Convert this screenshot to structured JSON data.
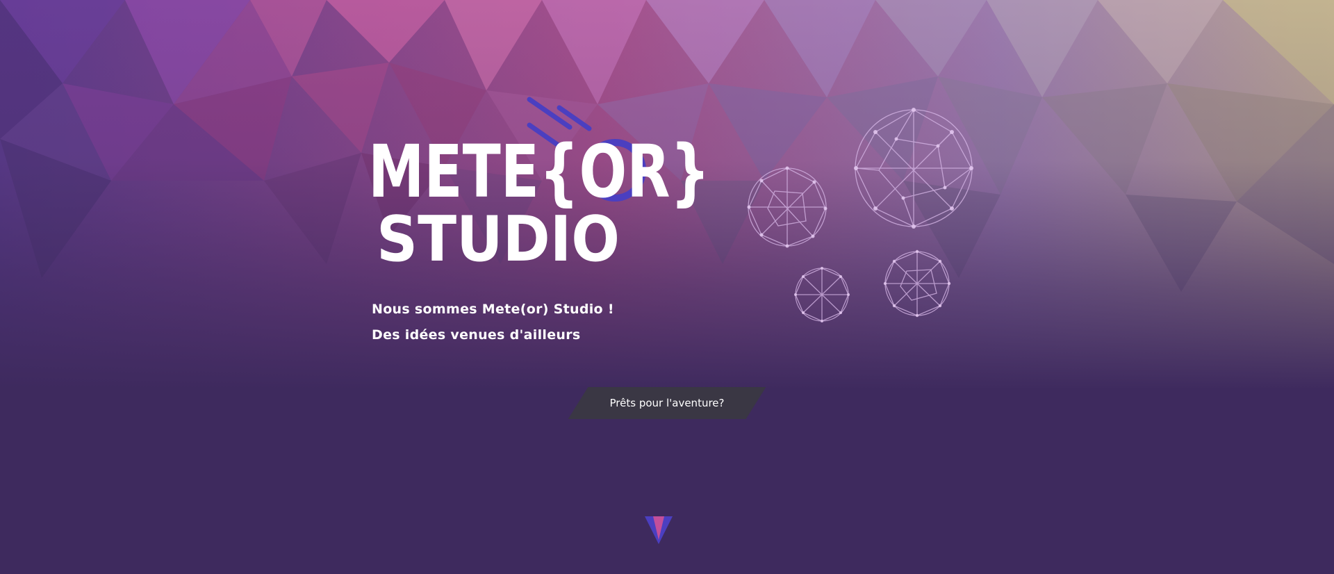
{
  "hero": {
    "logo_text_line1": "METE{OR}",
    "logo_text_line2": "STUDIO",
    "tagline_1": "Nous sommes Mete(or) Studio !",
    "tagline_2": "Des idées venues d'ailleurs",
    "cta_label": "Prêts pour l'aventure?"
  },
  "icons": {
    "logo": "meteor-studio-logo",
    "decoration": "network-spheres",
    "scroll": "chevron-down-icon"
  },
  "colors": {
    "background_dark": "#3e2a5e",
    "background_pink": "#a8508e",
    "accent_blue": "#4b3fc0",
    "arrow_pink": "#c24f9a",
    "button_bg": "#3a3842",
    "text": "#ffffff"
  }
}
